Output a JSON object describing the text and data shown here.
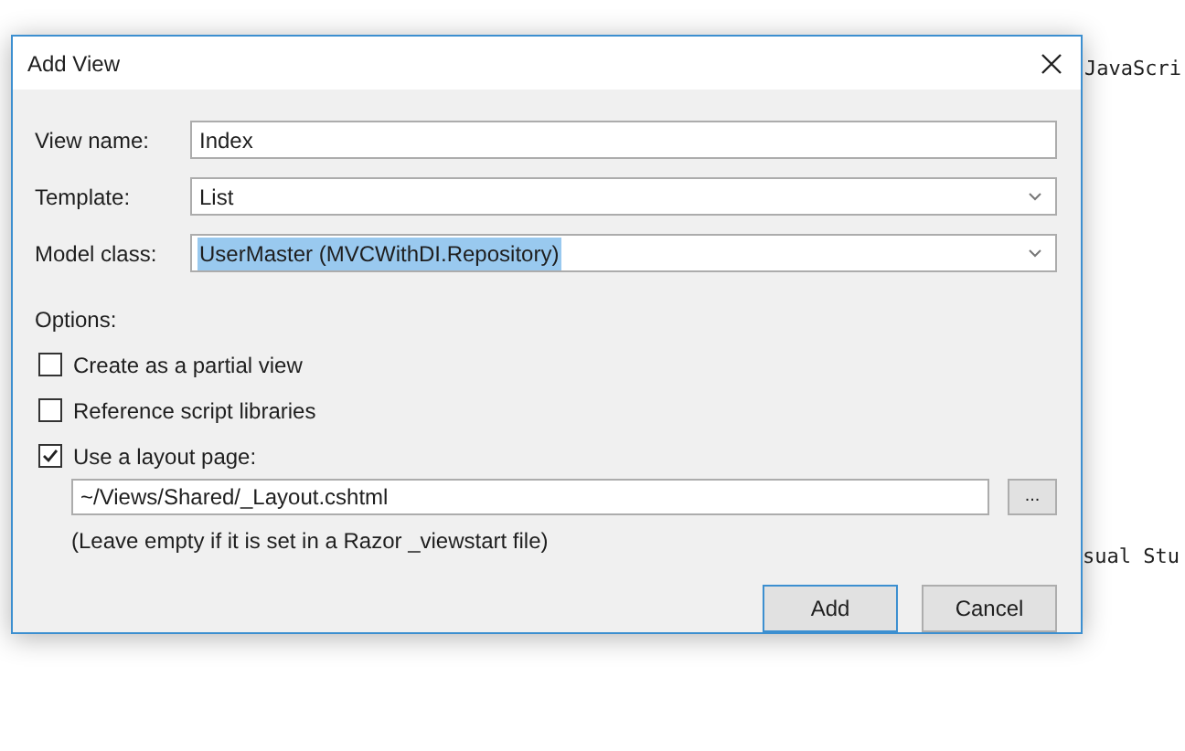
{
  "background_code": [
    {
      "text": "JavaScri"
    },
    {
      "text": "sual Stu"
    }
  ],
  "dialog": {
    "title": "Add View",
    "fields": [
      {
        "label": "View name:",
        "kind": "text",
        "value": "Index",
        "selected": false
      },
      {
        "label": "Template:",
        "kind": "dropdown",
        "value": "List",
        "selected": false
      },
      {
        "label": "Model class:",
        "kind": "dropdown",
        "value": "UserMaster (MVCWithDI.Repository)",
        "selected": true
      }
    ],
    "options_label": "Options:",
    "options": [
      {
        "label": "Create as a partial view",
        "checked": false
      },
      {
        "label": "Reference script libraries",
        "checked": false
      },
      {
        "label": "Use a layout page:",
        "checked": true
      }
    ],
    "layout_path": {
      "value": "~/Views/Shared/_Layout.cshtml",
      "browse": "..."
    },
    "hint": "(Leave empty if it is set in a Razor _viewstart file)",
    "buttons": [
      {
        "label": "Add",
        "selected": true
      },
      {
        "label": "Cancel",
        "selected": false
      }
    ]
  }
}
